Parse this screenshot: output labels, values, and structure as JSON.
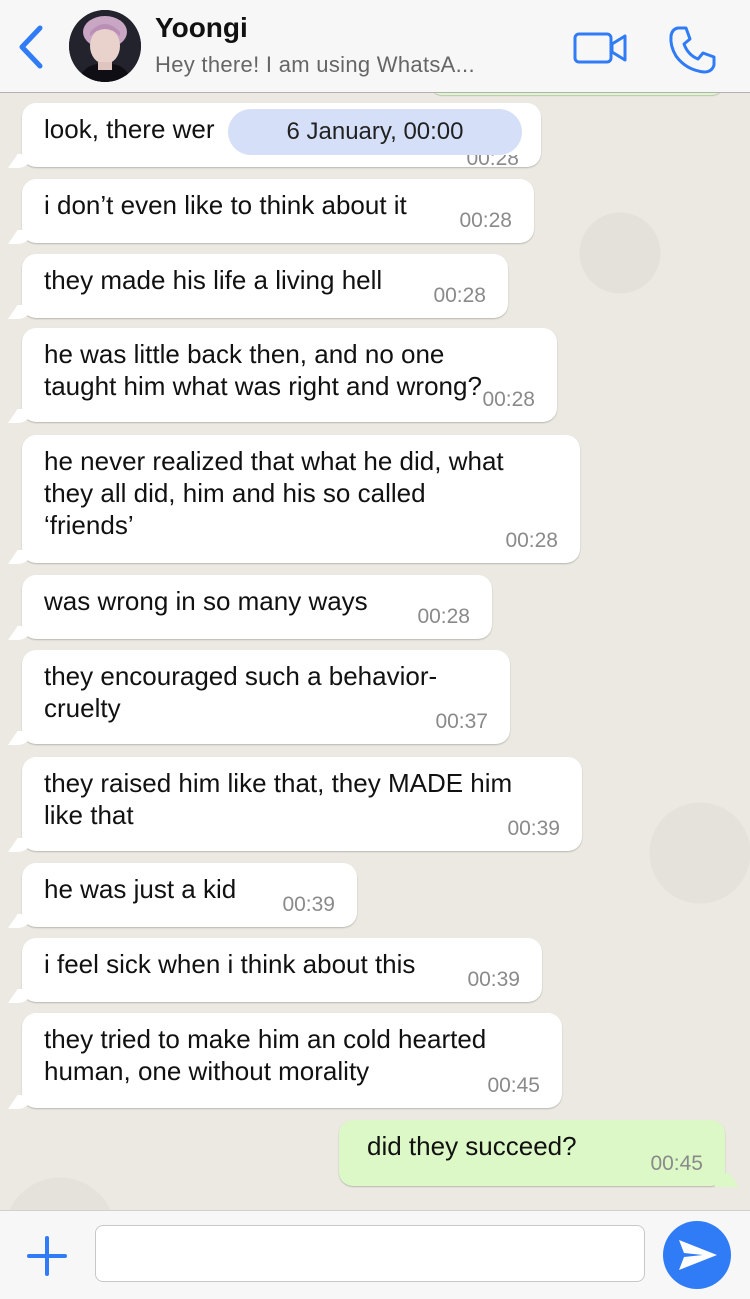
{
  "header": {
    "contact_name": "Yoongi",
    "contact_status": "Hey there! I am using WhatsA...",
    "icons": {
      "back": "chevron-left-icon",
      "video": "video-camera-icon",
      "call": "phone-icon"
    },
    "accent_color": "#2f7cf6"
  },
  "chat": {
    "date_label": "6 January, 00:00",
    "messages": [
      {
        "text": "look, there wer",
        "time": "00:28",
        "direction": "incoming"
      },
      {
        "text": "i don’t even like to think about it",
        "time": "00:28",
        "direction": "incoming"
      },
      {
        "text": "they made his life a living hell",
        "time": "00:28",
        "direction": "incoming"
      },
      {
        "text": "he was little back then, and no one\ntaught him what was right and wrong?",
        "time": "00:28",
        "direction": "incoming"
      },
      {
        "text": "he never realized that what he did, what\nthey all did, him and his so called\n‘friends’",
        "time": "00:28",
        "direction": "incoming"
      },
      {
        "text": "was wrong in so many ways",
        "time": "00:28",
        "direction": "incoming"
      },
      {
        "text": "they encouraged such a behavior-\ncruelty",
        "time": "00:37",
        "direction": "incoming"
      },
      {
        "text": "they raised him like that, they MADE him\nlike that",
        "time": "00:39",
        "direction": "incoming"
      },
      {
        "text": "he was just a kid",
        "time": "00:39",
        "direction": "incoming"
      },
      {
        "text": "i feel sick when i think about this",
        "time": "00:39",
        "direction": "incoming"
      },
      {
        "text": "they tried to make him an cold hearted\nhuman, one without morality",
        "time": "00:45",
        "direction": "incoming"
      },
      {
        "text": "did they succeed?",
        "time": "00:45",
        "direction": "outgoing"
      }
    ],
    "colors": {
      "incoming": "#ffffff",
      "outgoing": "#dcf8c6",
      "date_pill": "#d4dff8"
    }
  },
  "composer": {
    "input_value": "",
    "icons": {
      "attach": "plus-icon",
      "send": "send-icon"
    }
  }
}
